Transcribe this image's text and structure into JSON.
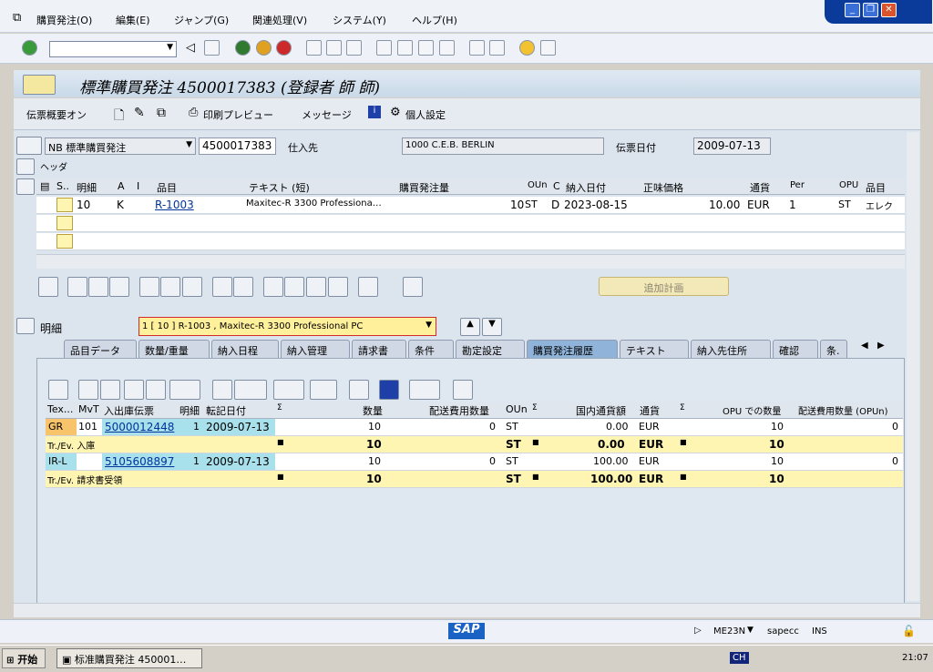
{
  "menu": [
    "購買発注(O)",
    "編集(E)",
    "ジャンプ(G)",
    "関連処理(V)",
    "システム(Y)",
    "ヘルプ(H)"
  ],
  "title": "標準購買発注 4500017383 (登録者 師 師)",
  "app_toolbar": {
    "doc_overview": "伝票概要オン",
    "print_preview": "印刷プレビュー",
    "messages": "メッセージ",
    "personal": "個人設定"
  },
  "header": {
    "doc_type": "NB 標準購買発注",
    "po_number": "4500017383",
    "vendor_label": "仕入先",
    "vendor_value": "1000 C.E.B. BERLIN",
    "date_label": "伝票日付",
    "date_value": "2009-07-13",
    "header_label": "ヘッダ"
  },
  "items_grid": {
    "columns": [
      "S..",
      "明細",
      "A",
      "I",
      "品目",
      "テキスト (短)",
      "購買発注量",
      "OUn",
      "C",
      "納入日付",
      "正味価格",
      "通貨",
      "Per",
      "OPU",
      "品目"
    ],
    "row": {
      "item": "10",
      "a": "K",
      "material": "R-1003",
      "text": "Maxitec-R 3300 Professiona…",
      "qty": "10",
      "oun": "ST",
      "c": "D",
      "delivery": "2023-08-15",
      "price": "10.00",
      "currency": "EUR",
      "per": "1",
      "opu": "ST",
      "matgroup": "エレク"
    },
    "add_plan_button": "追加計画"
  },
  "detail": {
    "label": "明細",
    "selector": "1 [ 10 ] R-1003 , Maxitec-R 3300 Professional PC",
    "tabs": [
      "品目データ",
      "数量/重量",
      "納入日程",
      "納入管理",
      "請求書",
      "条件",
      "勘定設定",
      "購買発注履歴",
      "テキスト",
      "納入先住所",
      "確認",
      "条."
    ],
    "active_tab": "購買発注履歴"
  },
  "history": {
    "columns": [
      "Tex...",
      "MvT",
      "入出庫伝票",
      "明細",
      "転記日付",
      "Σ",
      "数量",
      "配送費用数量",
      "OUn",
      "Σ",
      "国内通貨額",
      "通貨",
      "Σ",
      "OPU での数量",
      "配送費用数量 (OPUn)"
    ],
    "rows": [
      {
        "type": "GR",
        "mvt": "101",
        "doc": "5000012448",
        "item": "1",
        "date": "2009-07-13",
        "qty": "10",
        "fee": "0",
        "oun": "ST",
        "amount": "0.00",
        "cur": "EUR",
        "opu_qty": "10",
        "opu_fee": "0"
      },
      {
        "subtotal": "Tr./Ev. 入庫",
        "qty": "10",
        "oun": "ST",
        "amount": "0.00",
        "cur": "EUR",
        "opu_qty": "10"
      },
      {
        "type": "IR-L",
        "mvt": "",
        "doc": "5105608897",
        "item": "1",
        "date": "2009-07-13",
        "qty": "10",
        "fee": "0",
        "oun": "ST",
        "amount": "100.00",
        "cur": "EUR",
        "opu_qty": "10",
        "opu_fee": "0"
      },
      {
        "subtotal": "Tr./Ev. 請求書受領",
        "qty": "10",
        "oun": "ST",
        "amount": "100.00",
        "cur": "EUR",
        "opu_qty": "10"
      }
    ]
  },
  "status": {
    "logo": "SAP",
    "tcode": "ME23N",
    "server": "sapecc",
    "mode": "INS"
  },
  "taskbar": {
    "start": "开始",
    "window": "标准購買発注 450001…",
    "lang": "CH",
    "clock": "21:07"
  }
}
